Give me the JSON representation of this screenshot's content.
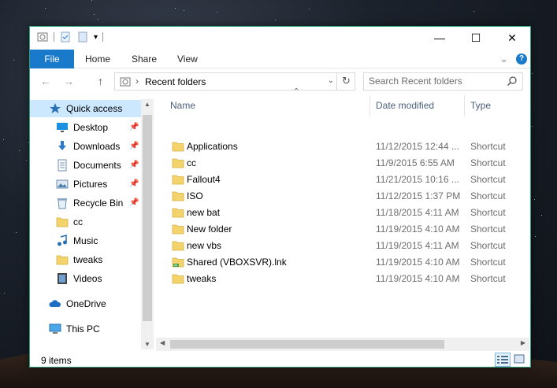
{
  "window": {
    "qat_dropdown": "▾",
    "minimize": "—",
    "maximize": "☐",
    "close": "✕"
  },
  "ribbon": {
    "tabs": [
      "File",
      "Home",
      "Share",
      "View"
    ],
    "expand": "⌄",
    "help": "?"
  },
  "address": {
    "back": "←",
    "forward": "→",
    "up": "↑",
    "separator": "›",
    "crumb": "Recent folders",
    "dropdown": "⌄",
    "refresh": "↻"
  },
  "search": {
    "placeholder": "Search Recent folders"
  },
  "nav": {
    "items": [
      {
        "label": "Quick access",
        "icon": "star-icon",
        "pinned": false
      },
      {
        "label": "Desktop",
        "icon": "desktop-icon",
        "pinned": true
      },
      {
        "label": "Downloads",
        "icon": "download-icon",
        "pinned": true
      },
      {
        "label": "Documents",
        "icon": "documents-icon",
        "pinned": true
      },
      {
        "label": "Pictures",
        "icon": "pictures-icon",
        "pinned": true
      },
      {
        "label": "Recycle Bin",
        "icon": "recycle-bin-icon",
        "pinned": true
      },
      {
        "label": "cc",
        "icon": "folder-icon",
        "pinned": false
      },
      {
        "label": "Music",
        "icon": "music-icon",
        "pinned": false
      },
      {
        "label": "tweaks",
        "icon": "folder-icon",
        "pinned": false
      },
      {
        "label": "Videos",
        "icon": "videos-icon",
        "pinned": false
      },
      {
        "label": "OneDrive",
        "icon": "cloud-icon",
        "pinned": false
      },
      {
        "label": "This PC",
        "icon": "computer-icon",
        "pinned": false
      }
    ]
  },
  "columns": {
    "name": "Name",
    "date": "Date modified",
    "type": "Type",
    "sort_indicator": "⌃"
  },
  "files": [
    {
      "name": "Applications",
      "date": "11/12/2015 12:44 ...",
      "type": "Shortcut",
      "icon": "folder-icon"
    },
    {
      "name": "cc",
      "date": "11/9/2015 6:55 AM",
      "type": "Shortcut",
      "icon": "folder-icon"
    },
    {
      "name": "Fallout4",
      "date": "11/21/2015 10:16 ...",
      "type": "Shortcut",
      "icon": "folder-icon"
    },
    {
      "name": "ISO",
      "date": "11/12/2015 1:37 PM",
      "type": "Shortcut",
      "icon": "folder-icon"
    },
    {
      "name": "new bat",
      "date": "11/18/2015 4:11 AM",
      "type": "Shortcut",
      "icon": "folder-icon"
    },
    {
      "name": "New folder",
      "date": "11/19/2015 4:10 AM",
      "type": "Shortcut",
      "icon": "folder-icon"
    },
    {
      "name": "new vbs",
      "date": "11/19/2015 4:11 AM",
      "type": "Shortcut",
      "icon": "folder-icon"
    },
    {
      "name": "Shared (VBOXSVR).lnk",
      "date": "11/19/2015 4:10 AM",
      "type": "Shortcut",
      "icon": "network-share-icon"
    },
    {
      "name": "tweaks",
      "date": "11/19/2015 4:10 AM",
      "type": "Shortcut",
      "icon": "folder-icon"
    }
  ],
  "status": {
    "count": "9 items"
  },
  "colors": {
    "accent": "#1979ca",
    "border": "#2aa37a",
    "selection": "#cce8ff",
    "folder": "#f3d36b"
  }
}
